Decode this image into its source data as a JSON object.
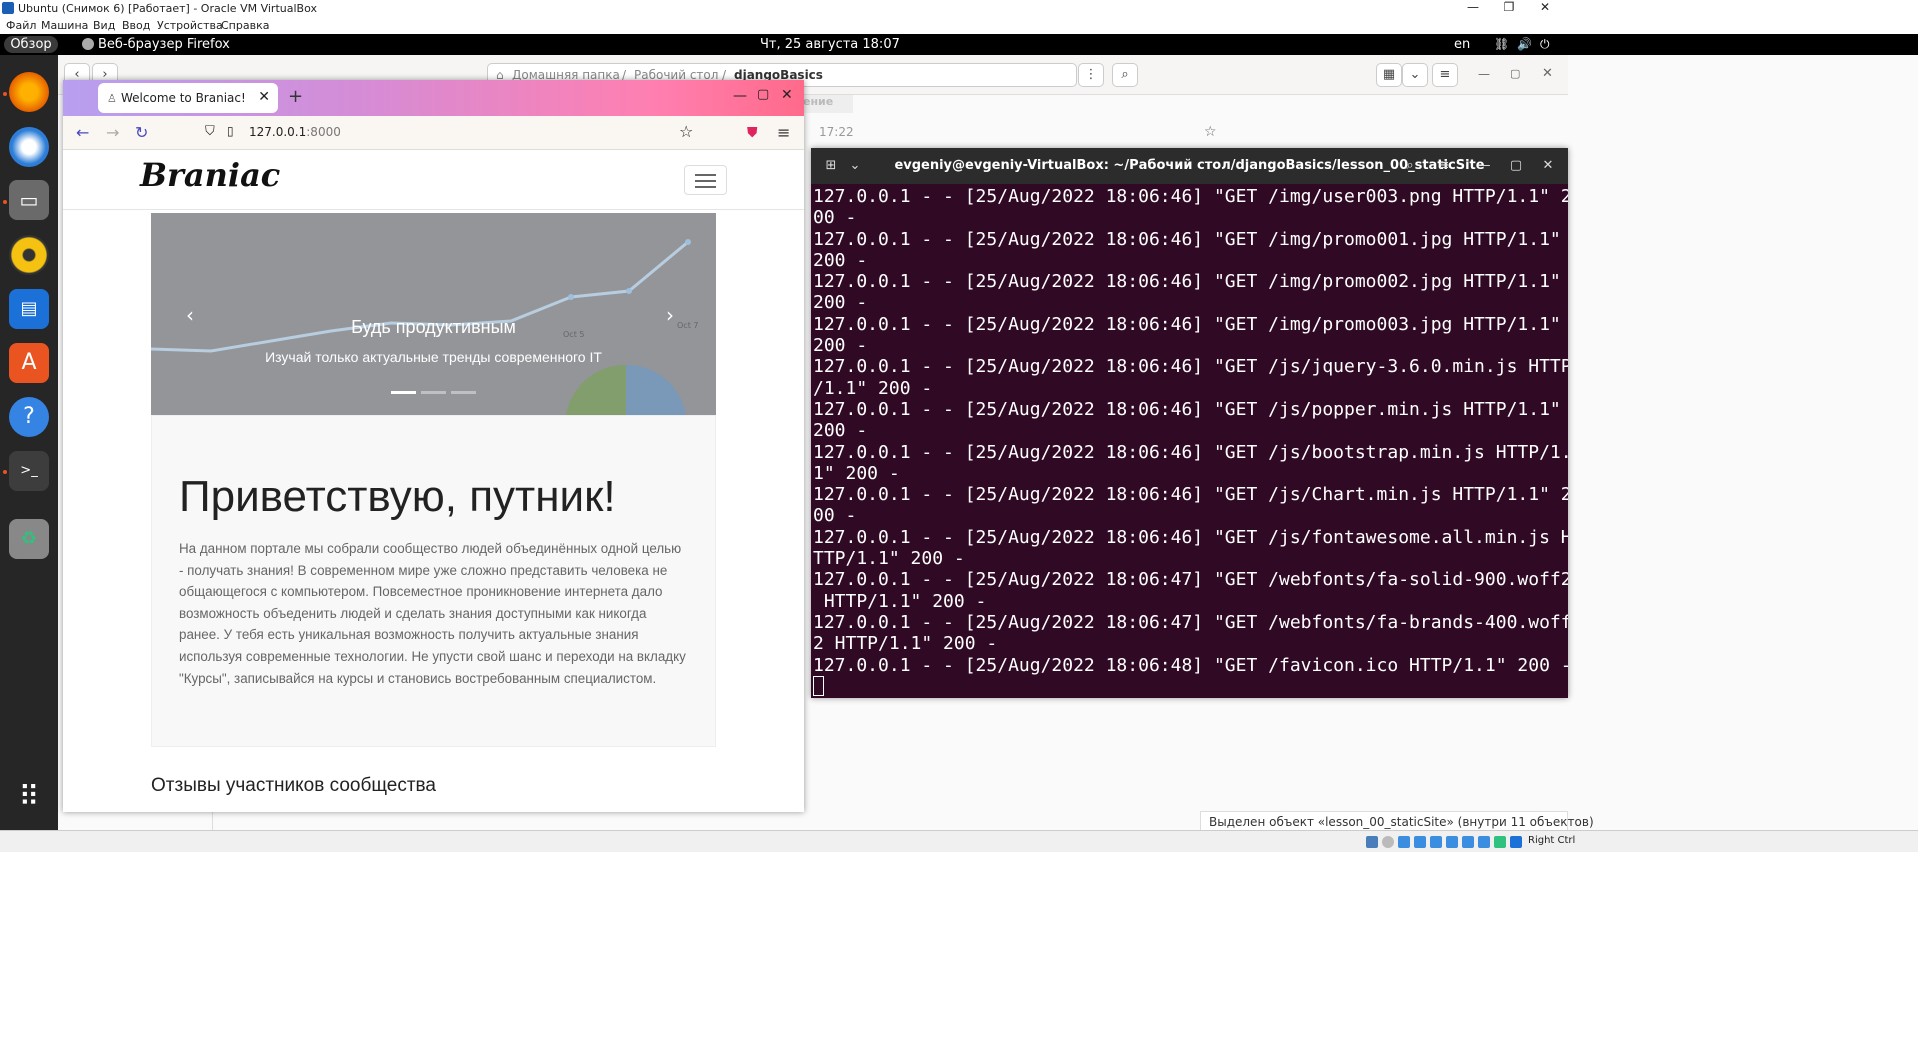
{
  "vbox": {
    "title": "Ubuntu (Снимок 6) [Работает] - Oracle VM VirtualBox",
    "menu": [
      "Файл",
      "Машина",
      "Вид",
      "Ввод",
      "Устройства",
      "Справка"
    ],
    "status_right": "Right Ctrl"
  },
  "topbar": {
    "overview": "Обзор",
    "app": "Веб-браузер Firefox",
    "clock": "Чт, 25 августа  18:07",
    "lang": "en"
  },
  "files": {
    "path": [
      "Домашняя папка",
      "Рабочий стол",
      "djangoBasics"
    ],
    "bg_tab": "ение",
    "bg_time": "17:22",
    "status": "Выделен объект «lesson_00_staticSite» (внутри 11 объектов)"
  },
  "firefox": {
    "tab_title": "Welcome to Braniac!",
    "url_host": "127.0.0.1",
    "url_port": ":8000"
  },
  "site": {
    "brand": "Braniac",
    "carousel": {
      "caption_title": "Будь продуктивным",
      "caption_text": "Изучай только актуальные тренды современного IT",
      "chart_labels": [
        "Oct 5",
        "Oct 7"
      ],
      "active_slide": 1,
      "slides": 3
    },
    "jumbotron": {
      "heading": "Приветствую, путник!",
      "text": "На данном портале мы собрали сообщество людей объединённых одной целью - получать знания! В современном мире уже сложно представить человека не общающегося с компьютером. Повсеместное проникновение интернета дало возможность объеденить людей и сделать знания доступными как никогда ранее. У тебя есть уникальная возможность получить актуальные знания используя современные технологии. Не упусти свой шанс и переходи на вкладку \"Курсы\", записывайся на курсы и становись востребованным специалистом."
    },
    "reviews_heading": "Отзывы участников сообщества"
  },
  "terminal": {
    "title": "evgeniy@evgeniy-VirtualBox: ~/Рабочий стол/djangoBasics/lesson_00_staticSite",
    "lines": [
      "127.0.0.1 - - [25/Aug/2022 18:06:46] \"GET /img/user003.png HTTP/1.1\" 2",
      "00 -",
      "127.0.0.1 - - [25/Aug/2022 18:06:46] \"GET /img/promo001.jpg HTTP/1.1\"",
      "200 -",
      "127.0.0.1 - - [25/Aug/2022 18:06:46] \"GET /img/promo002.jpg HTTP/1.1\"",
      "200 -",
      "127.0.0.1 - - [25/Aug/2022 18:06:46] \"GET /img/promo003.jpg HTTP/1.1\"",
      "200 -",
      "127.0.0.1 - - [25/Aug/2022 18:06:46] \"GET /js/jquery-3.6.0.min.js HTTP",
      "/1.1\" 200 -",
      "127.0.0.1 - - [25/Aug/2022 18:06:46] \"GET /js/popper.min.js HTTP/1.1\"",
      "200 -",
      "127.0.0.1 - - [25/Aug/2022 18:06:46] \"GET /js/bootstrap.min.js HTTP/1.",
      "1\" 200 -",
      "127.0.0.1 - - [25/Aug/2022 18:06:46] \"GET /js/Chart.min.js HTTP/1.1\" 2",
      "00 -",
      "127.0.0.1 - - [25/Aug/2022 18:06:46] \"GET /js/fontawesome.all.min.js H",
      "TTP/1.1\" 200 -",
      "127.0.0.1 - - [25/Aug/2022 18:06:47] \"GET /webfonts/fa-solid-900.woff2",
      " HTTP/1.1\" 200 -",
      "127.0.0.1 - - [25/Aug/2022 18:06:47] \"GET /webfonts/fa-brands-400.woff",
      "2 HTTP/1.1\" 200 -",
      "127.0.0.1 - - [25/Aug/2022 18:06:48] \"GET /favicon.ico HTTP/1.1\" 200 -"
    ]
  },
  "dock": [
    "firefox-icon",
    "thunderbird-icon",
    "files-icon",
    "rhythmbox-icon",
    "writer-icon",
    "software-icon",
    "help-icon",
    "terminal-icon",
    "trash-icon",
    "apps-grid-icon"
  ]
}
